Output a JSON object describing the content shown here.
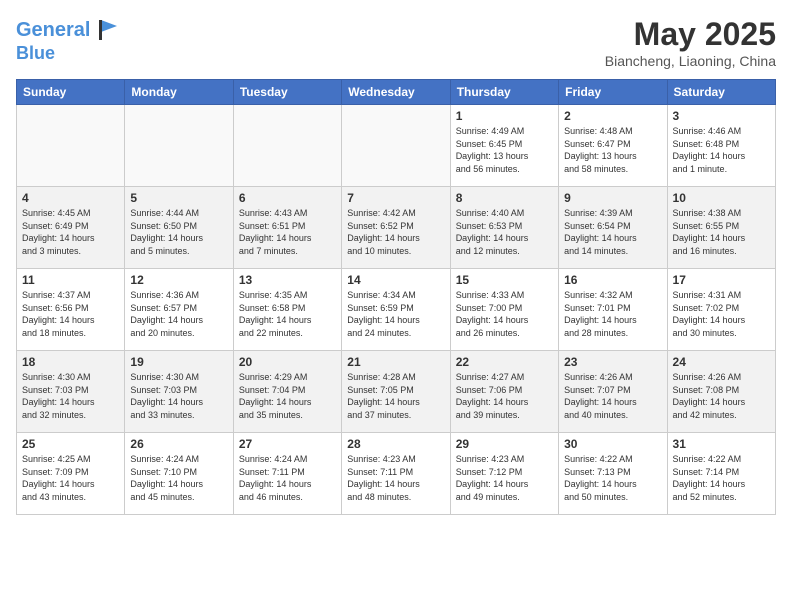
{
  "header": {
    "logo_line1": "General",
    "logo_line2": "Blue",
    "title": "May 2025",
    "subtitle": "Biancheng, Liaoning, China"
  },
  "weekdays": [
    "Sunday",
    "Monday",
    "Tuesday",
    "Wednesday",
    "Thursday",
    "Friday",
    "Saturday"
  ],
  "weeks": [
    [
      {
        "day": "",
        "detail": ""
      },
      {
        "day": "",
        "detail": ""
      },
      {
        "day": "",
        "detail": ""
      },
      {
        "day": "",
        "detail": ""
      },
      {
        "day": "1",
        "detail": "Sunrise: 4:49 AM\nSunset: 6:45 PM\nDaylight: 13 hours\nand 56 minutes."
      },
      {
        "day": "2",
        "detail": "Sunrise: 4:48 AM\nSunset: 6:47 PM\nDaylight: 13 hours\nand 58 minutes."
      },
      {
        "day": "3",
        "detail": "Sunrise: 4:46 AM\nSunset: 6:48 PM\nDaylight: 14 hours\nand 1 minute."
      }
    ],
    [
      {
        "day": "4",
        "detail": "Sunrise: 4:45 AM\nSunset: 6:49 PM\nDaylight: 14 hours\nand 3 minutes."
      },
      {
        "day": "5",
        "detail": "Sunrise: 4:44 AM\nSunset: 6:50 PM\nDaylight: 14 hours\nand 5 minutes."
      },
      {
        "day": "6",
        "detail": "Sunrise: 4:43 AM\nSunset: 6:51 PM\nDaylight: 14 hours\nand 7 minutes."
      },
      {
        "day": "7",
        "detail": "Sunrise: 4:42 AM\nSunset: 6:52 PM\nDaylight: 14 hours\nand 10 minutes."
      },
      {
        "day": "8",
        "detail": "Sunrise: 4:40 AM\nSunset: 6:53 PM\nDaylight: 14 hours\nand 12 minutes."
      },
      {
        "day": "9",
        "detail": "Sunrise: 4:39 AM\nSunset: 6:54 PM\nDaylight: 14 hours\nand 14 minutes."
      },
      {
        "day": "10",
        "detail": "Sunrise: 4:38 AM\nSunset: 6:55 PM\nDaylight: 14 hours\nand 16 minutes."
      }
    ],
    [
      {
        "day": "11",
        "detail": "Sunrise: 4:37 AM\nSunset: 6:56 PM\nDaylight: 14 hours\nand 18 minutes."
      },
      {
        "day": "12",
        "detail": "Sunrise: 4:36 AM\nSunset: 6:57 PM\nDaylight: 14 hours\nand 20 minutes."
      },
      {
        "day": "13",
        "detail": "Sunrise: 4:35 AM\nSunset: 6:58 PM\nDaylight: 14 hours\nand 22 minutes."
      },
      {
        "day": "14",
        "detail": "Sunrise: 4:34 AM\nSunset: 6:59 PM\nDaylight: 14 hours\nand 24 minutes."
      },
      {
        "day": "15",
        "detail": "Sunrise: 4:33 AM\nSunset: 7:00 PM\nDaylight: 14 hours\nand 26 minutes."
      },
      {
        "day": "16",
        "detail": "Sunrise: 4:32 AM\nSunset: 7:01 PM\nDaylight: 14 hours\nand 28 minutes."
      },
      {
        "day": "17",
        "detail": "Sunrise: 4:31 AM\nSunset: 7:02 PM\nDaylight: 14 hours\nand 30 minutes."
      }
    ],
    [
      {
        "day": "18",
        "detail": "Sunrise: 4:30 AM\nSunset: 7:03 PM\nDaylight: 14 hours\nand 32 minutes."
      },
      {
        "day": "19",
        "detail": "Sunrise: 4:30 AM\nSunset: 7:03 PM\nDaylight: 14 hours\nand 33 minutes."
      },
      {
        "day": "20",
        "detail": "Sunrise: 4:29 AM\nSunset: 7:04 PM\nDaylight: 14 hours\nand 35 minutes."
      },
      {
        "day": "21",
        "detail": "Sunrise: 4:28 AM\nSunset: 7:05 PM\nDaylight: 14 hours\nand 37 minutes."
      },
      {
        "day": "22",
        "detail": "Sunrise: 4:27 AM\nSunset: 7:06 PM\nDaylight: 14 hours\nand 39 minutes."
      },
      {
        "day": "23",
        "detail": "Sunrise: 4:26 AM\nSunset: 7:07 PM\nDaylight: 14 hours\nand 40 minutes."
      },
      {
        "day": "24",
        "detail": "Sunrise: 4:26 AM\nSunset: 7:08 PM\nDaylight: 14 hours\nand 42 minutes."
      }
    ],
    [
      {
        "day": "25",
        "detail": "Sunrise: 4:25 AM\nSunset: 7:09 PM\nDaylight: 14 hours\nand 43 minutes."
      },
      {
        "day": "26",
        "detail": "Sunrise: 4:24 AM\nSunset: 7:10 PM\nDaylight: 14 hours\nand 45 minutes."
      },
      {
        "day": "27",
        "detail": "Sunrise: 4:24 AM\nSunset: 7:11 PM\nDaylight: 14 hours\nand 46 minutes."
      },
      {
        "day": "28",
        "detail": "Sunrise: 4:23 AM\nSunset: 7:11 PM\nDaylight: 14 hours\nand 48 minutes."
      },
      {
        "day": "29",
        "detail": "Sunrise: 4:23 AM\nSunset: 7:12 PM\nDaylight: 14 hours\nand 49 minutes."
      },
      {
        "day": "30",
        "detail": "Sunrise: 4:22 AM\nSunset: 7:13 PM\nDaylight: 14 hours\nand 50 minutes."
      },
      {
        "day": "31",
        "detail": "Sunrise: 4:22 AM\nSunset: 7:14 PM\nDaylight: 14 hours\nand 52 minutes."
      }
    ]
  ]
}
